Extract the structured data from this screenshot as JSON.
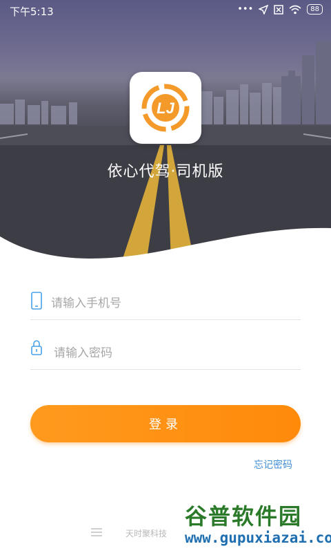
{
  "status_bar": {
    "time": "下午5:13",
    "dots": "•••",
    "battery": "88"
  },
  "app": {
    "title": "依心代驾·司机版",
    "logo_text": "LJ"
  },
  "form": {
    "phone_placeholder": "请输入手机号",
    "password_placeholder": "请输入密码",
    "login_label": "登录",
    "forgot_label": "忘记密码"
  },
  "footer": {
    "company": "天时聚科技"
  },
  "watermark": {
    "title": "谷普软件园",
    "url": "www.gupuxiazai.com"
  },
  "colors": {
    "accent": "#ff8c0f",
    "link": "#3f8ed6",
    "logo_orange": "#f39a2b"
  },
  "icons": [
    "wifi-icon",
    "location-icon",
    "sim-icon",
    "battery-icon",
    "phone-icon",
    "lock-icon",
    "menu-icon"
  ]
}
